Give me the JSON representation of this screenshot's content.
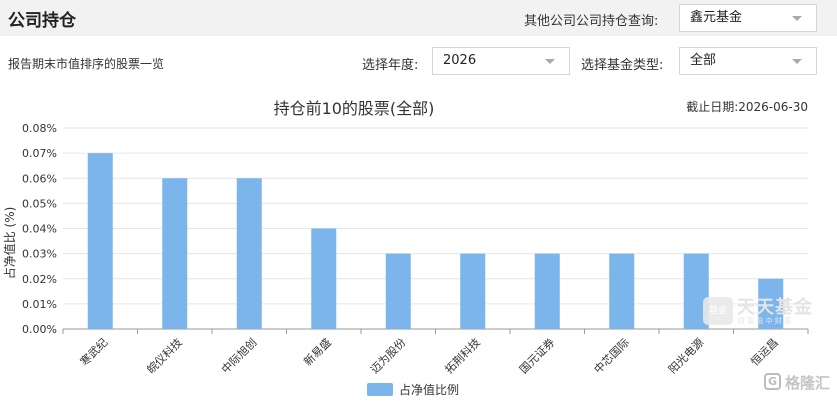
{
  "header": {
    "title": "公司持仓",
    "other_query_label": "其他公司公司持仓查询:",
    "company_select": "鑫元基金"
  },
  "filters": {
    "subtitle": "报告期末市值排序的股票一览",
    "year_label": "选择年度:",
    "year_value": "2026",
    "type_label": "选择基金类型:",
    "type_value": "全部"
  },
  "chart_data": {
    "type": "bar",
    "title": "持仓前10的股票(全部)",
    "date_note": "截止日期:2026-06-30",
    "ylabel": "占净值比 (%)",
    "xlabel": "",
    "categories": [
      "寒武纪",
      "皖仪科技",
      "中际旭创",
      "新易盛",
      "迈为股份",
      "拓荆科技",
      "国元证券",
      "中芯国际",
      "阳光电源",
      "恒运昌"
    ],
    "series": [
      {
        "name": "占净值比例",
        "values": [
          0.07,
          0.06,
          0.06,
          0.04,
          0.03,
          0.03,
          0.03,
          0.03,
          0.03,
          0.02
        ]
      }
    ],
    "ylim": [
      0,
      0.08
    ],
    "yticks": [
      "0.00%",
      "0.01%",
      "0.02%",
      "0.03%",
      "0.04%",
      "0.05%",
      "0.06%",
      "0.07%",
      "0.08%"
    ],
    "grid": true,
    "legend": "bottom-center",
    "bar_color": "#7cb5ec"
  },
  "watermarks": {
    "brand": "天天基金",
    "brand_small": "基金",
    "brand_sub": "财 富 盈 中 财 富",
    "corner": "格隆汇"
  }
}
